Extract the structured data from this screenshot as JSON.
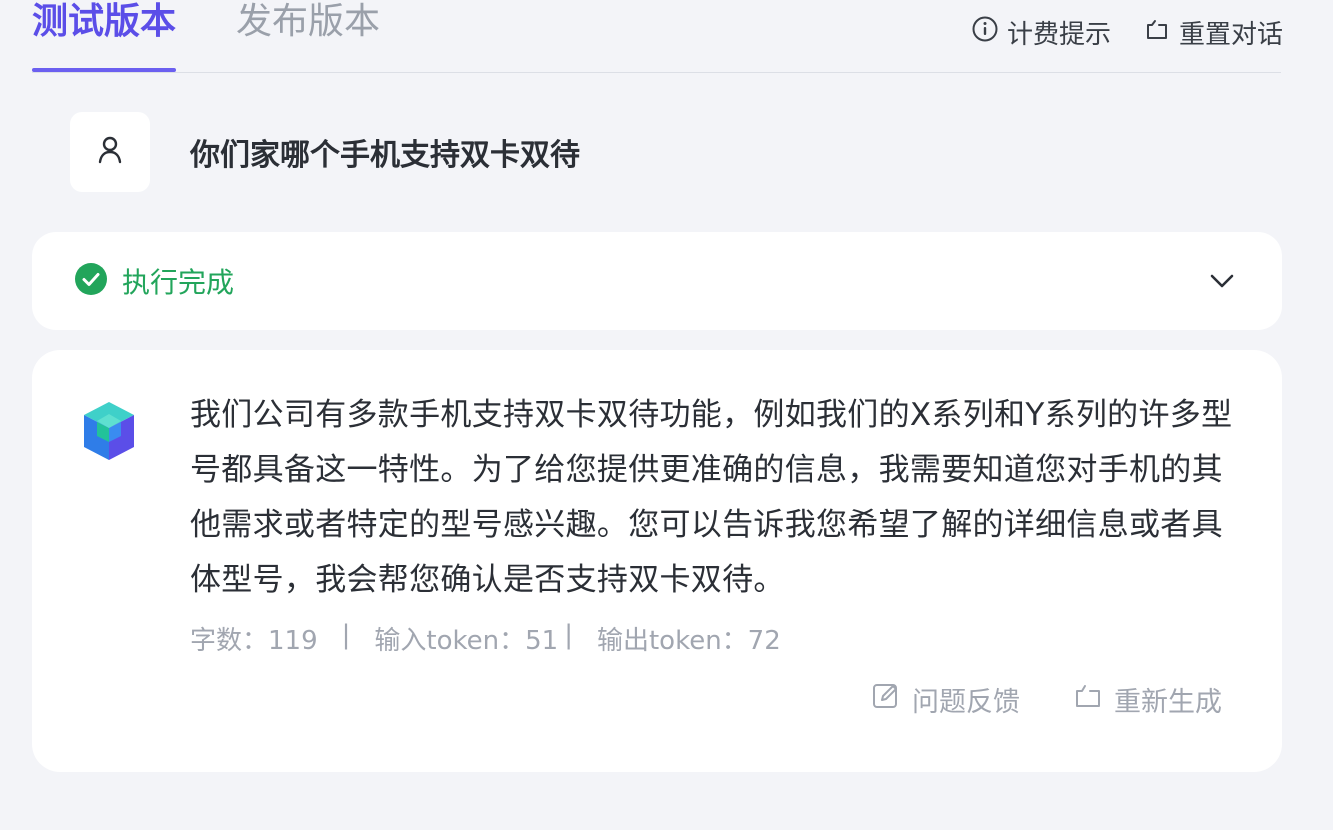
{
  "tabs": [
    {
      "label": "测试版本",
      "active": true
    },
    {
      "label": "发布版本",
      "active": false
    }
  ],
  "header_actions": {
    "billing_hint": "计费提示",
    "reset_chat": "重置对话"
  },
  "user_message": "你们家哪个手机支持双卡双待",
  "status": {
    "text": "执行完成",
    "color": "#22a55b"
  },
  "answer": {
    "text": "我们公司有多款手机支持双卡双待功能，例如我们的X系列和Y系列的许多型号都具备这一特性。为了给您提供更准确的信息，我需要知道您对手机的其他需求或者特定的型号感兴趣。您可以告诉我您希望了解的详细信息或者具体型号，我会帮您确认是否支持双卡双待。",
    "meta": {
      "char_count": "字数：119",
      "sep1": "|",
      "input_tokens": "输入token：51",
      "sep2": "|",
      "output_tokens": "输出token：72"
    },
    "actions": {
      "feedback": "问题反馈",
      "regenerate": "重新生成"
    }
  },
  "colors": {
    "accent": "#5b4ee8",
    "background": "#f3f4f8",
    "success": "#22a55b"
  },
  "icons": {
    "billing": "info-circle-icon",
    "reset": "reset-icon",
    "user": "user-icon",
    "status": "check-circle-icon",
    "expand": "chevron-down-icon",
    "bot": "cube-logo-icon",
    "feedback": "edit-icon",
    "regenerate": "refresh-icon"
  }
}
